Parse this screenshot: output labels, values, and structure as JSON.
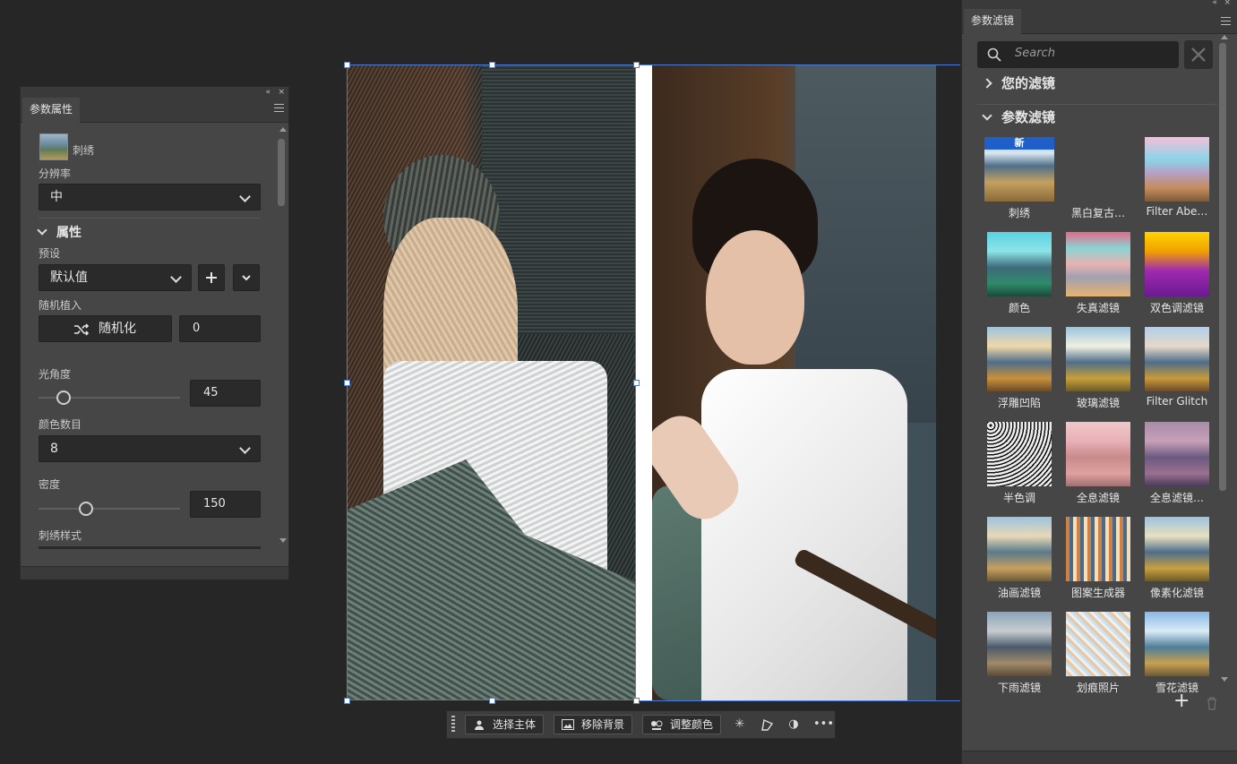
{
  "props_panel": {
    "tab": "参数属性",
    "collapse": "«",
    "close": "×",
    "filter_name": "刺绣",
    "resolution_label": "分辨率",
    "resolution_value": "中",
    "attributes_header": "属性",
    "preset_label": "预设",
    "preset_value": "默认值",
    "random_seed_label": "随机植入",
    "randomize_label": "随机化",
    "seed_value": "0",
    "light_angle_label": "光角度",
    "light_angle_value": "45",
    "light_angle_level": 0.17,
    "color_count_label": "颜色数目",
    "color_count_value": "8",
    "density_label": "密度",
    "density_value": "150",
    "density_level": 0.33,
    "stitch_style_label": "刺绣样式"
  },
  "taskbar": {
    "select_subject": "选择主体",
    "remove_bg": "移除背景",
    "adjust_color": "调整颜色"
  },
  "filters_panel": {
    "tab": "参数滤镜",
    "search_placeholder": "Search",
    "your_filters": "您的滤镜",
    "param_filters": "参数滤镜",
    "new_badge": "新",
    "tiles": [
      {
        "label": "刺绣",
        "icon": "embroidery-thumbnail"
      },
      {
        "label": "黑白复古…",
        "icon": "retro-bw-thumbnail"
      },
      {
        "label": "Filter Abe…",
        "icon": "filter-aberration-thumbnail"
      },
      {
        "label": "颜色",
        "icon": "color-thumbnail"
      },
      {
        "label": "失真滤镜",
        "icon": "distort-thumbnail"
      },
      {
        "label": "双色调滤镜",
        "icon": "duotone-thumbnail"
      },
      {
        "label": "浮雕凹陷",
        "icon": "emboss-thumbnail"
      },
      {
        "label": "玻璃滤镜",
        "icon": "glass-thumbnail"
      },
      {
        "label": "Filter Glitch",
        "icon": "glitch-thumbnail"
      },
      {
        "label": "半色调",
        "icon": "halftone-thumbnail"
      },
      {
        "label": "全息滤镜",
        "icon": "hologram-thumbnail"
      },
      {
        "label": "全息滤镜…",
        "icon": "hologram2-thumbnail"
      },
      {
        "label": "油画滤镜",
        "icon": "oil-paint-thumbnail"
      },
      {
        "label": "图案生成器",
        "icon": "pattern-thumbnail"
      },
      {
        "label": "像素化滤镜",
        "icon": "pixelate-thumbnail"
      },
      {
        "label": "下雨滤镜",
        "icon": "rain-thumbnail"
      },
      {
        "label": "划痕照片",
        "icon": "scratch-thumbnail"
      },
      {
        "label": "雪花滤镜",
        "icon": "snow-thumbnail"
      }
    ],
    "add": "+",
    "delete": "trash-icon"
  }
}
